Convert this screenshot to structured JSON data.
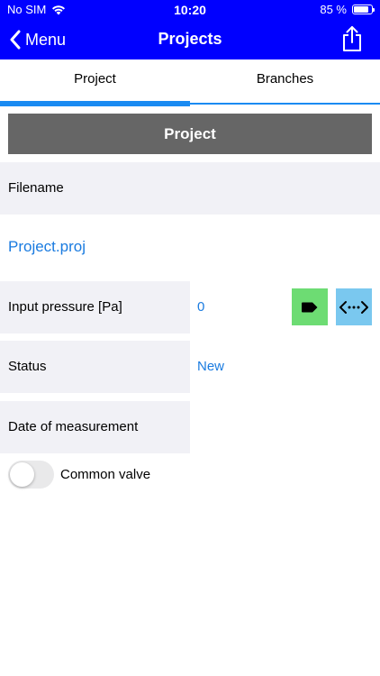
{
  "status_bar": {
    "carrier": "No SIM",
    "time": "10:20",
    "battery": "85 %",
    "battery_level": 0.85
  },
  "nav": {
    "back_label": "Menu",
    "title": "Projects"
  },
  "tabs": [
    {
      "label": "Project",
      "active": true
    },
    {
      "label": "Branches",
      "active": false
    }
  ],
  "section_button": "Project",
  "fields": {
    "filename_label": "Filename",
    "filename_value": "Project.proj",
    "input_pressure_label": "Input pressure [Pa]",
    "input_pressure_value": "0",
    "status_label": "Status",
    "status_value": "New",
    "date_label": "Date of measurement"
  },
  "toggle": {
    "label": "Common valve",
    "on": false
  },
  "colors": {
    "header": "#0000ff",
    "tab_accent": "#1a8bf2",
    "link": "#1a7be0",
    "tag_button": "#6ddc73",
    "arrow_button": "#7ac8ef"
  }
}
